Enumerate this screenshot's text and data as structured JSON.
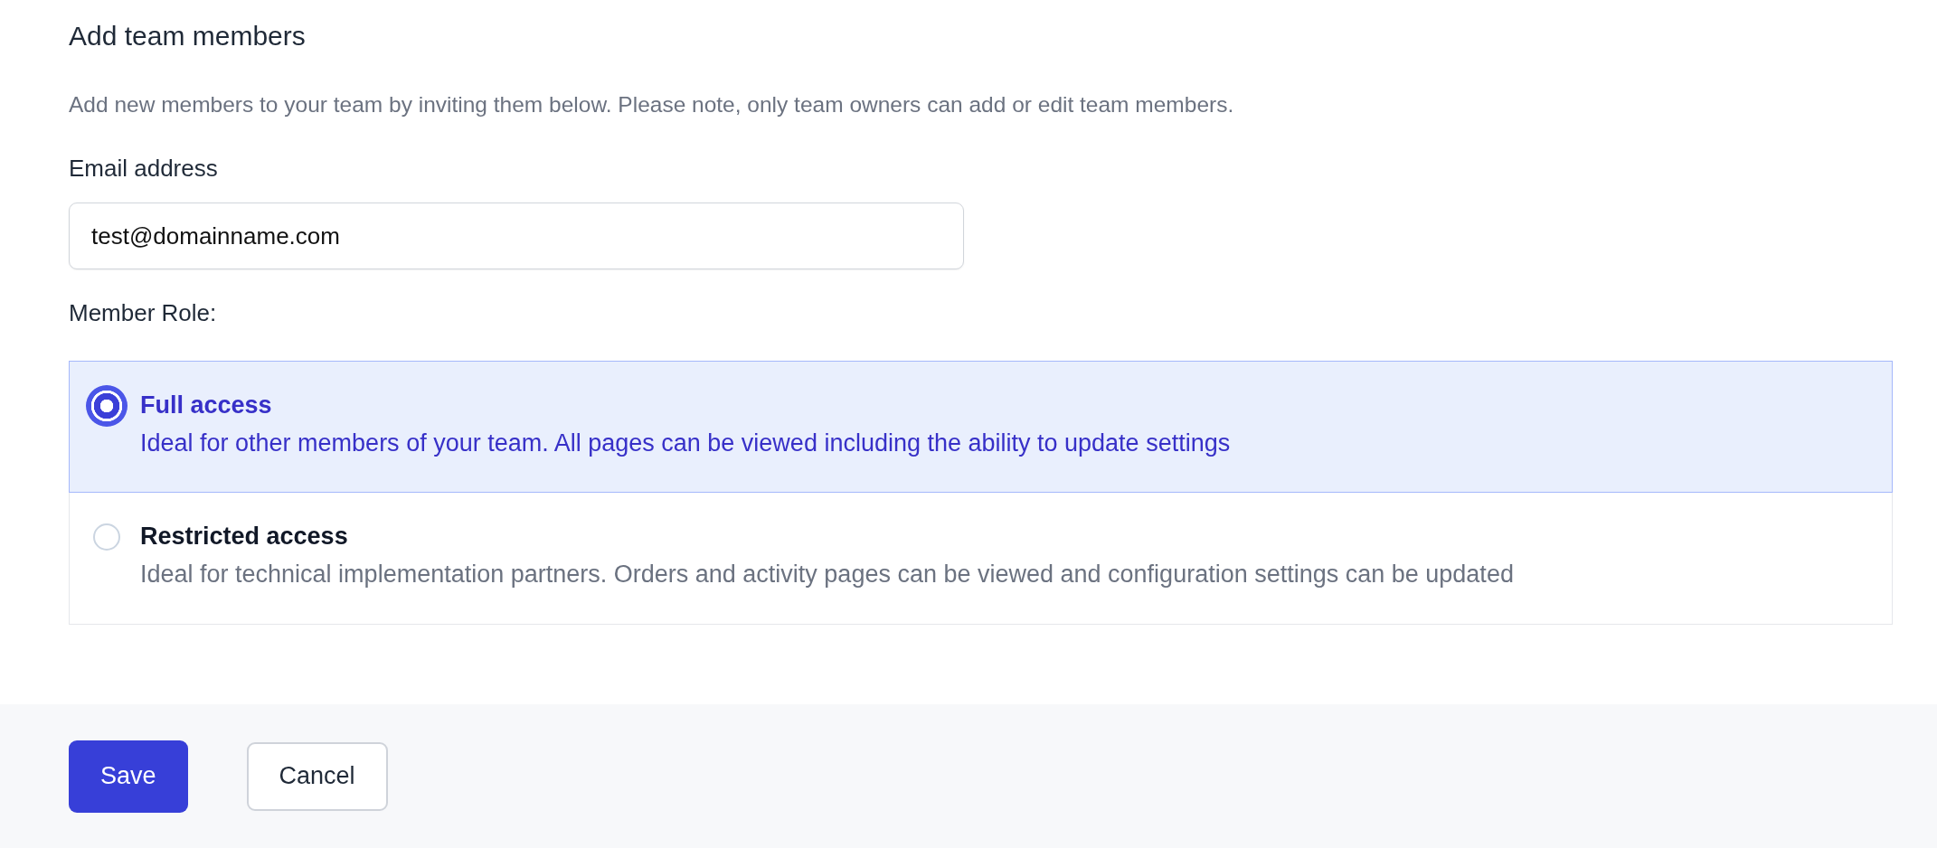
{
  "heading": "Add team members",
  "description": "Add new members to your team by inviting them below. Please note, only team owners can add or edit team members.",
  "email": {
    "label": "Email address",
    "value": "test@domainname.com"
  },
  "role": {
    "label": "Member Role:",
    "options": [
      {
        "title": "Full access",
        "description": "Ideal for other members of your team. All pages can be viewed including the ability to update settings",
        "selected": true
      },
      {
        "title": "Restricted access",
        "description": "Ideal for technical implementation partners. Orders and activity pages can be viewed and configuration settings can be updated",
        "selected": false
      }
    ]
  },
  "buttons": [
    {
      "label": "Save",
      "kind": "primary"
    },
    {
      "label": "Cancel",
      "kind": "secondary"
    }
  ]
}
